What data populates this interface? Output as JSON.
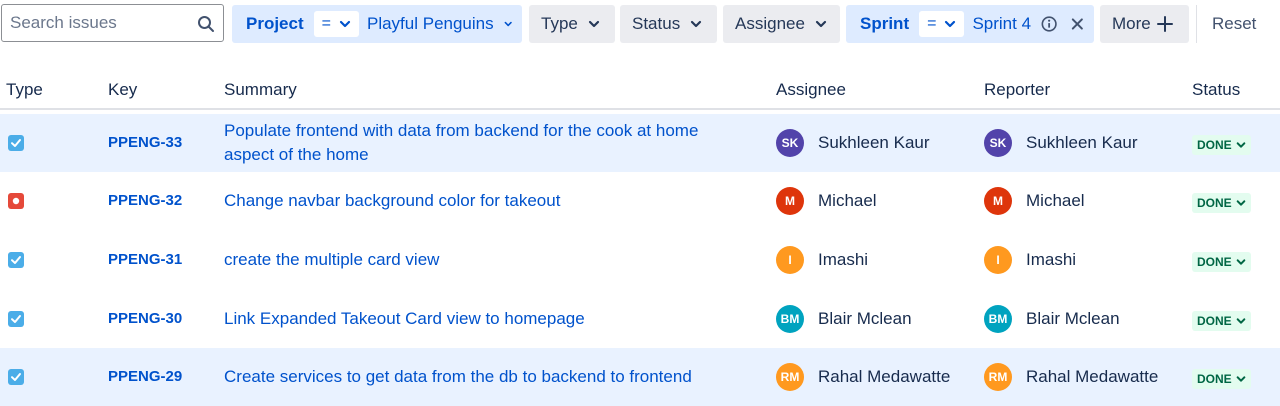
{
  "filters": {
    "search_placeholder": "Search issues",
    "project": {
      "label": "Project",
      "operator": "=",
      "value": "Playful Penguins"
    },
    "type_label": "Type",
    "status_label": "Status",
    "assignee_label": "Assignee",
    "sprint": {
      "label": "Sprint",
      "operator": "=",
      "value": "Sprint 4"
    },
    "more_label": "More",
    "reset_label": "Reset"
  },
  "table": {
    "headers": {
      "type": "Type",
      "key": "Key",
      "summary": "Summary",
      "assignee": "Assignee",
      "reporter": "Reporter",
      "status": "Status"
    },
    "rows": [
      {
        "type": "task",
        "key": "PPENG-33",
        "summary_line1": "Populate frontend with data from backend for the cook at home",
        "summary_line2": "aspect of the home",
        "assignee": {
          "initials": "SK",
          "name": "Sukhleen Kaur",
          "color": "#5243aa"
        },
        "reporter": {
          "initials": "SK",
          "name": "Sukhleen Kaur",
          "color": "#5243aa"
        },
        "status": "DONE",
        "selected": true
      },
      {
        "type": "bug",
        "key": "PPENG-32",
        "summary_line1": "Change navbar background color for takeout",
        "summary_line2": "",
        "assignee": {
          "initials": "M",
          "name": "Michael",
          "color": "#de350b"
        },
        "reporter": {
          "initials": "M",
          "name": "Michael",
          "color": "#de350b"
        },
        "status": "DONE",
        "selected": false
      },
      {
        "type": "task",
        "key": "PPENG-31",
        "summary_line1": "create the multiple card view",
        "summary_line2": "",
        "assignee": {
          "initials": "I",
          "name": "Imashi",
          "color": "#ff991f"
        },
        "reporter": {
          "initials": "I",
          "name": "Imashi",
          "color": "#ff991f"
        },
        "status": "DONE",
        "selected": false
      },
      {
        "type": "task",
        "key": "PPENG-30",
        "summary_line1": "Link Expanded Takeout Card view to homepage",
        "summary_line2": "",
        "assignee": {
          "initials": "BM",
          "name": "Blair Mclean",
          "color": "#00a3bf"
        },
        "reporter": {
          "initials": "BM",
          "name": "Blair Mclean",
          "color": "#00a3bf"
        },
        "status": "DONE",
        "selected": false
      },
      {
        "type": "task",
        "key": "PPENG-29",
        "summary_line1": "Create services to get data from the db to backend to frontend",
        "summary_line2": "",
        "assignee": {
          "initials": "RM",
          "name": "Rahal Medawatte",
          "color": "#ff991f"
        },
        "reporter": {
          "initials": "RM",
          "name": "Rahal Medawatte",
          "color": "#ff991f"
        },
        "status": "DONE",
        "selected": true
      }
    ]
  },
  "icons": {
    "search": "search-icon",
    "chevron": "chevron-down-icon",
    "info": "info-icon",
    "close": "close-icon",
    "plus": "plus-icon",
    "task": "task-icon",
    "bug": "bug-icon"
  }
}
